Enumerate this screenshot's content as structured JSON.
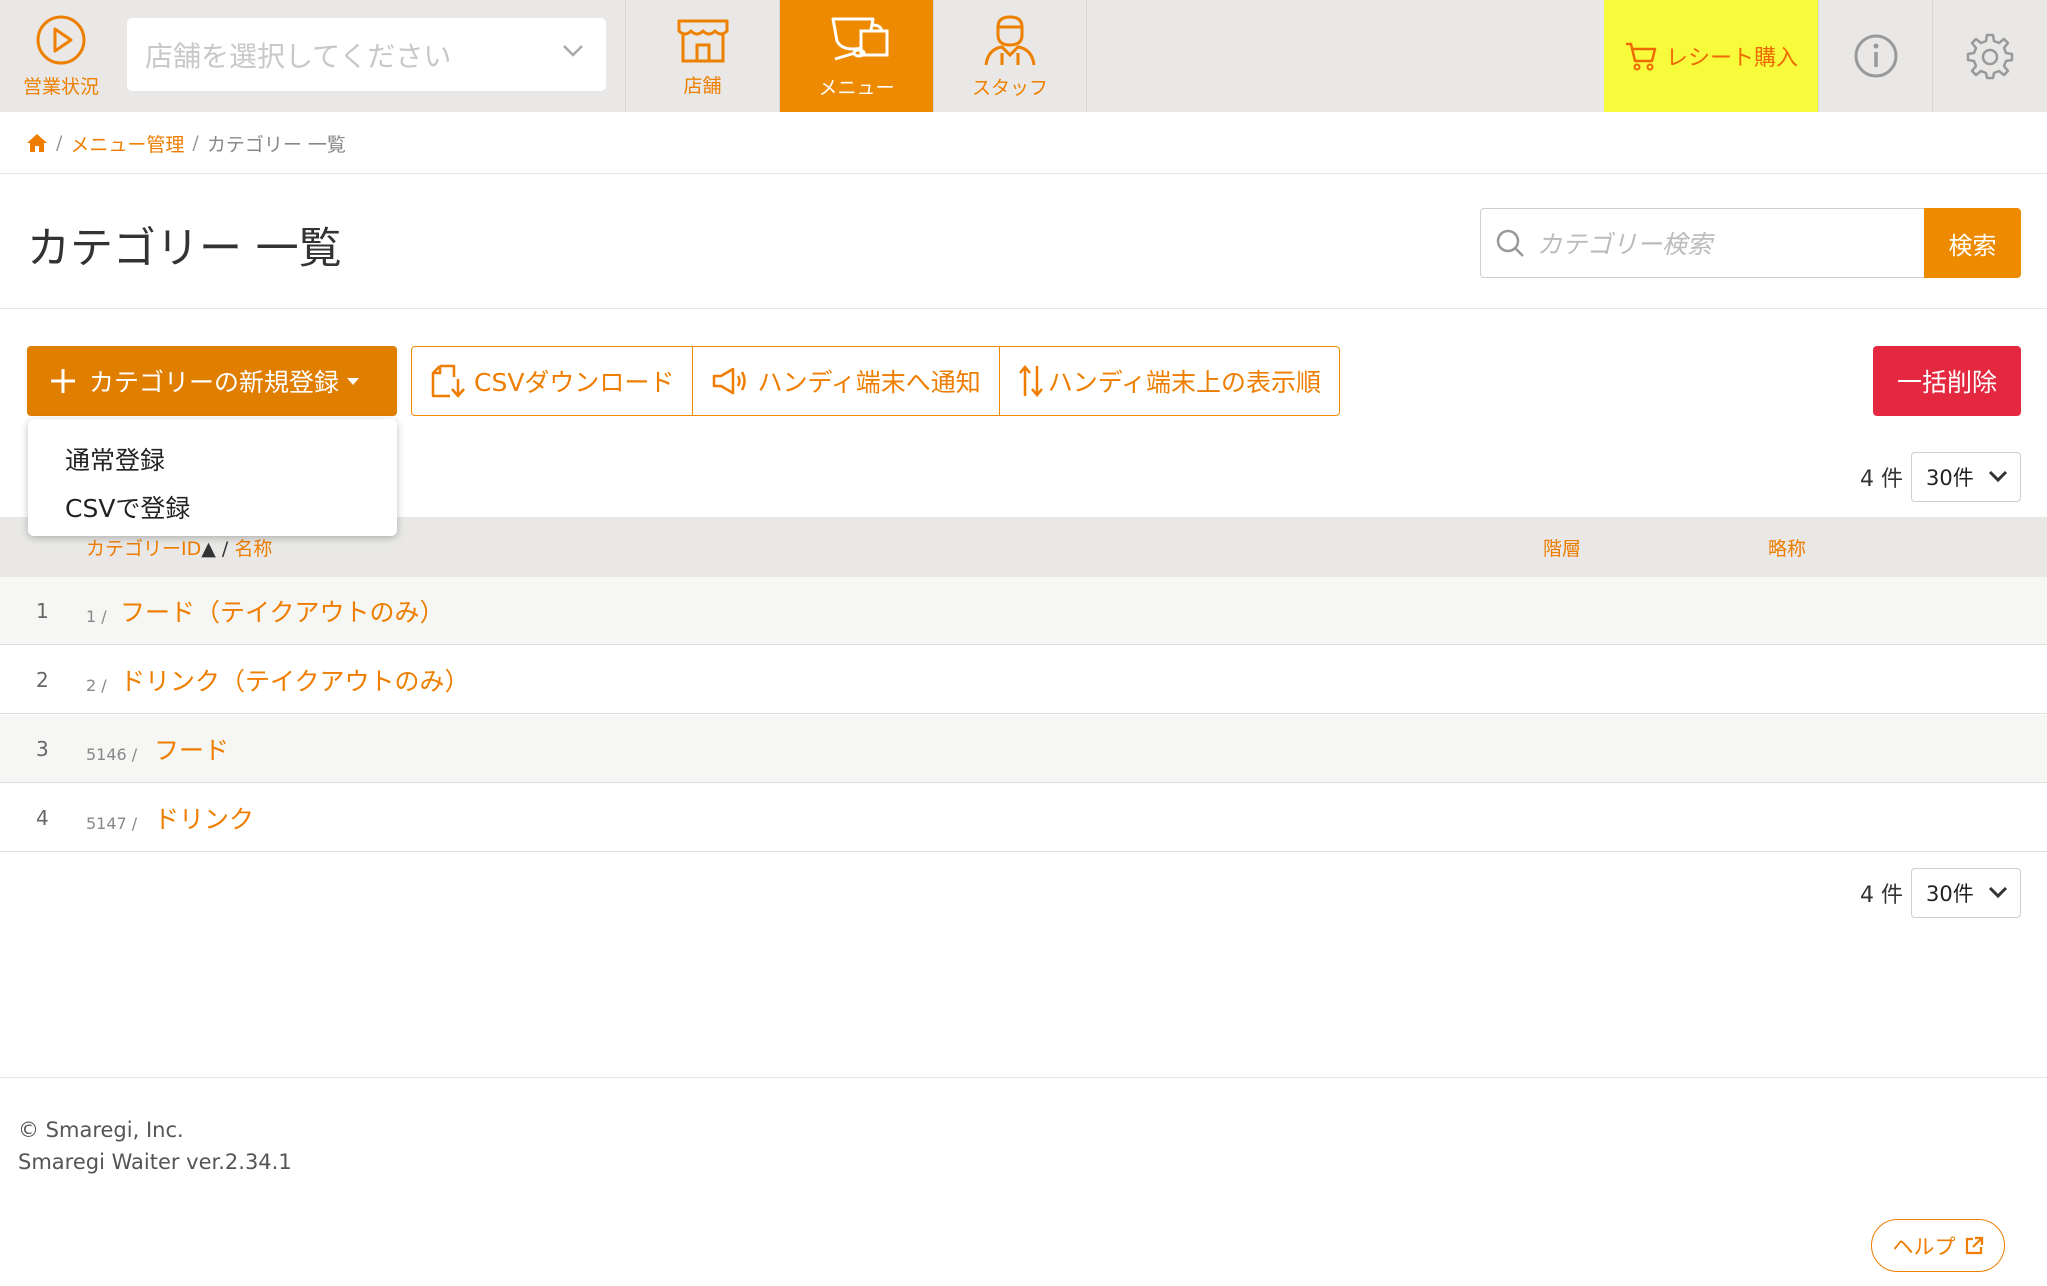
{
  "topnav": {
    "status_label": "営業状況",
    "store_placeholder": "店舗を選択してください",
    "tabs": [
      {
        "label": "店舗",
        "icon": "store-icon"
      },
      {
        "label": "メニュー",
        "icon": "cafe-menu-icon"
      },
      {
        "label": "スタッフ",
        "icon": "staff-icon"
      }
    ],
    "receipt_label": "レシート購入",
    "accent": "#ee8a00",
    "receipt_bg": "#f8fa3c"
  },
  "breadcrumb": {
    "items": [
      "メニュー管理",
      "カテゴリー 一覧"
    ]
  },
  "page": {
    "title": "カテゴリー 一覧",
    "search_placeholder": "カテゴリー検索",
    "search_button": "検索"
  },
  "toolbar": {
    "new_label": "カテゴリーの新規登録",
    "csv_download": "CSVダウンロード",
    "notify": "ハンディ端末へ通知",
    "order": "ハンディ端末上の表示順",
    "bulk_delete": "一括削除",
    "delete_color": "#e3283f"
  },
  "dropdown": {
    "items": [
      "通常登録",
      "CSVで登録"
    ]
  },
  "pager": {
    "count": "4 件",
    "per_page": "30件"
  },
  "table": {
    "headers": {
      "id_name_id": "カテゴリーID",
      "sort_mark": "▲",
      "id_name_sep": "/",
      "id_name_name": "名称",
      "level": "階層",
      "abbr": "略称"
    },
    "rows": [
      {
        "num": "1",
        "id": "1 /",
        "name": "フード（テイクアウトのみ）"
      },
      {
        "num": "2",
        "id": "2 /",
        "name": "ドリンク（テイクアウトのみ）"
      },
      {
        "num": "3",
        "id": "5146 /",
        "name": "フード"
      },
      {
        "num": "4",
        "id": "5147 /",
        "name": "ドリンク"
      }
    ]
  },
  "footer": {
    "copyright": "© Smaregi, Inc.",
    "version": "Smaregi Waiter ver.2.34.1",
    "help": "ヘルプ"
  }
}
